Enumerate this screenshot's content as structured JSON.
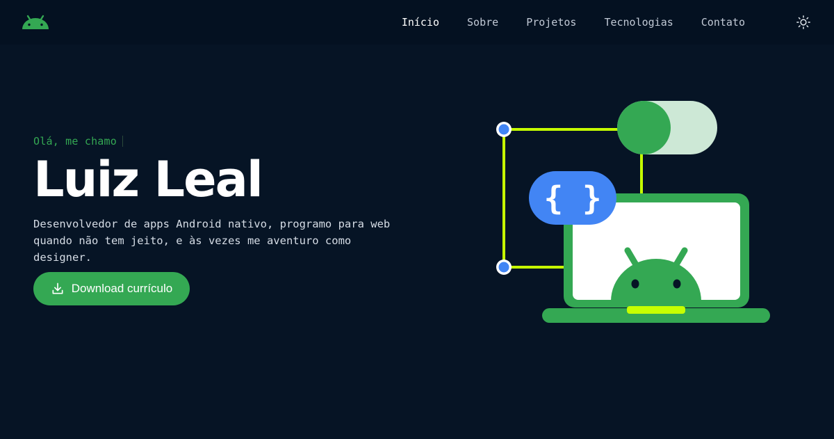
{
  "nav": {
    "logo_icon": "android-icon",
    "links": [
      {
        "label": "Início",
        "active": true
      },
      {
        "label": "Sobre",
        "active": false
      },
      {
        "label": "Projetos",
        "active": false
      },
      {
        "label": "Tecnologias",
        "active": false
      },
      {
        "label": "Contato",
        "active": false
      }
    ],
    "theme_icon": "sun-icon"
  },
  "hero": {
    "greeting": "Olá, me chamo",
    "name": "Luiz Leal",
    "description": "Desenvolvedor de apps Android nativo, programo para web quando não tem jeito, e às vezes me aventuro como designer.",
    "download_label": "Download currículo",
    "download_icon": "download-icon"
  },
  "illustration": {
    "code_badge": "{ }",
    "icons": [
      "android-laptop-illustration",
      "toggle-switch-icon"
    ]
  },
  "colors": {
    "background": "#061425",
    "accent_green": "#34a853",
    "accent_blue": "#4285f4",
    "accent_lime": "#c6ff00",
    "text_primary": "#ffffff"
  }
}
